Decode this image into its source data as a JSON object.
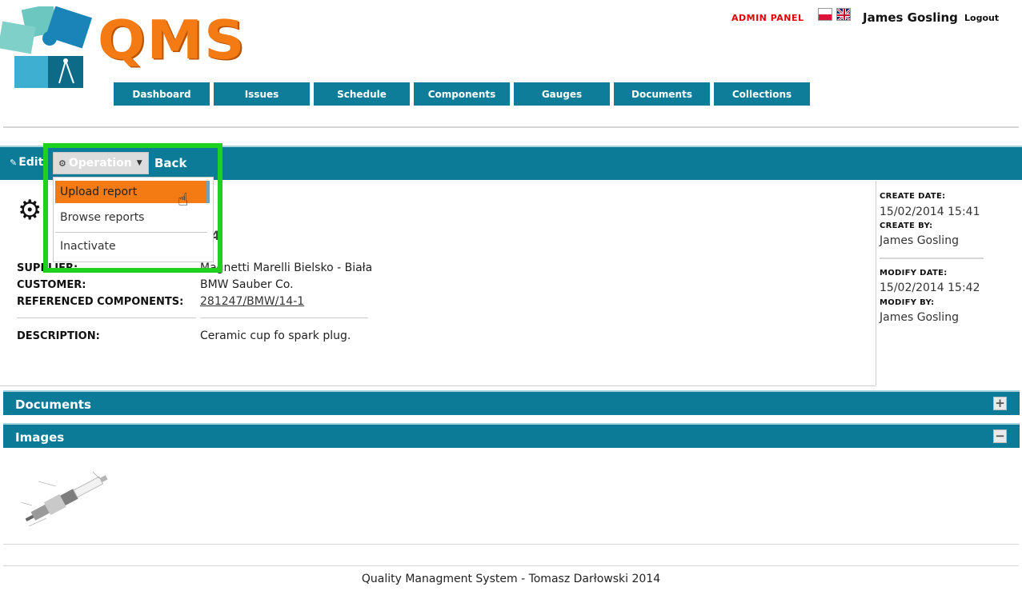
{
  "app": {
    "logo_text": "QMS",
    "admin_label": "ADMIN PANEL",
    "user_name": "James Gosling",
    "logout_label": "Logout"
  },
  "nav": {
    "items": [
      "Dashboard",
      "Issues",
      "Schedule",
      "Components",
      "Gauges",
      "Documents",
      "Collections"
    ]
  },
  "toolbar": {
    "edit_label": "Edit",
    "operation_label": "Operation",
    "back_label": "Back"
  },
  "operation_menu": {
    "items": [
      "Upload report",
      "Browse reports",
      "Inactivate"
    ]
  },
  "detail": {
    "title_fragment": "4",
    "supplier_label": "SUPPLIER:",
    "supplier_value": "Magnetti Marelli Bielsko - Biała",
    "customer_label": "CUSTOMER:",
    "customer_value": "BMW Sauber Co.",
    "ref_label": "REFERENCED COMPONENTS:",
    "ref_value": "281247/BMW/14-1",
    "description_label": "DESCRIPTION:",
    "description_value": "Ceramic cup fo spark plug."
  },
  "meta": {
    "create_date_label": "CREATE DATE:",
    "create_date": "15/02/2014 15:41",
    "create_by_label": "CREATE BY:",
    "create_by": "James Gosling",
    "modify_date_label": "MODIFY DATE:",
    "modify_date": "15/02/2014 15:42",
    "modify_by_label": "MODIFY BY:",
    "modify_by": "James Gosling"
  },
  "sections": {
    "documents_title": "Documents",
    "documents_toggle": "+",
    "images_title": "Images",
    "images_toggle": "−"
  },
  "footer": {
    "text": "Quality Managment System - Tomasz Darłowski 2014"
  },
  "colors": {
    "brand_teal": "#0c7b98",
    "brand_orange": "#f47b14",
    "highlight_green": "#1fd11f",
    "admin_red": "#e30000"
  },
  "icons": {
    "edit": "pencil-icon",
    "operation": "gear-icon",
    "dropdown": "caret-down-icon",
    "record": "gears-icon",
    "pointer": "hand-cursor-icon"
  }
}
